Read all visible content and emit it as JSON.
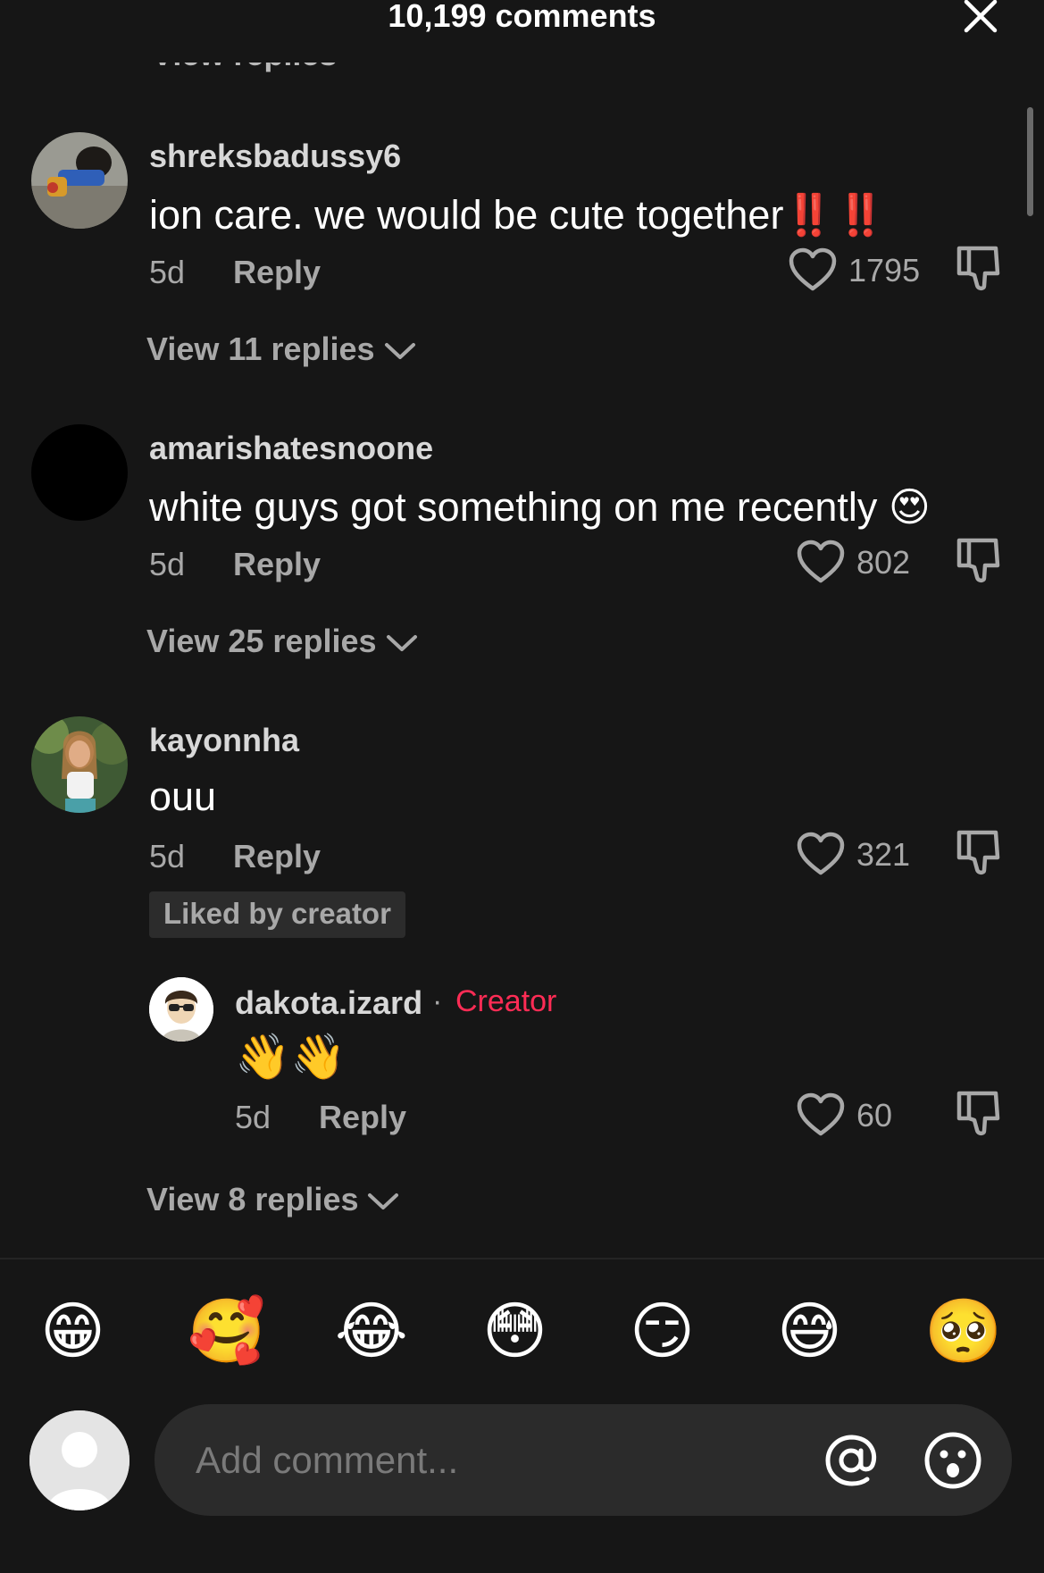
{
  "header": {
    "title": "10,199 comments",
    "close_icon": "close-icon"
  },
  "comments": [
    {
      "username": "shreksbadussy6",
      "text": "ion care. we would be cute together",
      "text_suffix": "‼️‼️",
      "age": "5d",
      "reply_label": "Reply",
      "likes": "1795",
      "view_replies": "View 11 replies"
    },
    {
      "username": "amarishatesnoone",
      "text": "white guys got something on me recently ",
      "text_suffix": "😍",
      "age": "5d",
      "reply_label": "Reply",
      "likes": "802",
      "view_replies": "View 25 replies"
    },
    {
      "username": "kayonnha",
      "text": "ouu",
      "age": "5d",
      "reply_label": "Reply",
      "likes": "321",
      "badge": "Liked by creator",
      "view_replies": "View 8 replies",
      "creator_reply": {
        "username": "dakota.izard",
        "separator": "·",
        "tag": "Creator",
        "text": "👋👋",
        "age": "5d",
        "reply_label": "Reply",
        "likes": "60"
      }
    }
  ],
  "quick_emojis": [
    "😁",
    "🥰",
    "😂",
    "😳",
    "😏",
    "😅",
    "🥺"
  ],
  "input": {
    "placeholder": "Add comment...",
    "mention_symbol": "@"
  },
  "colors": {
    "background": "#161616",
    "creator_accent": "#fe2c55",
    "secondary_text": "#a8a8a8",
    "input_background": "#2b2b2b"
  },
  "icons": [
    "close-icon",
    "heart-icon",
    "dislike-icon",
    "chevron-down-icon",
    "mention-icon",
    "emoji-icon",
    "avatar-placeholder-icon"
  ]
}
